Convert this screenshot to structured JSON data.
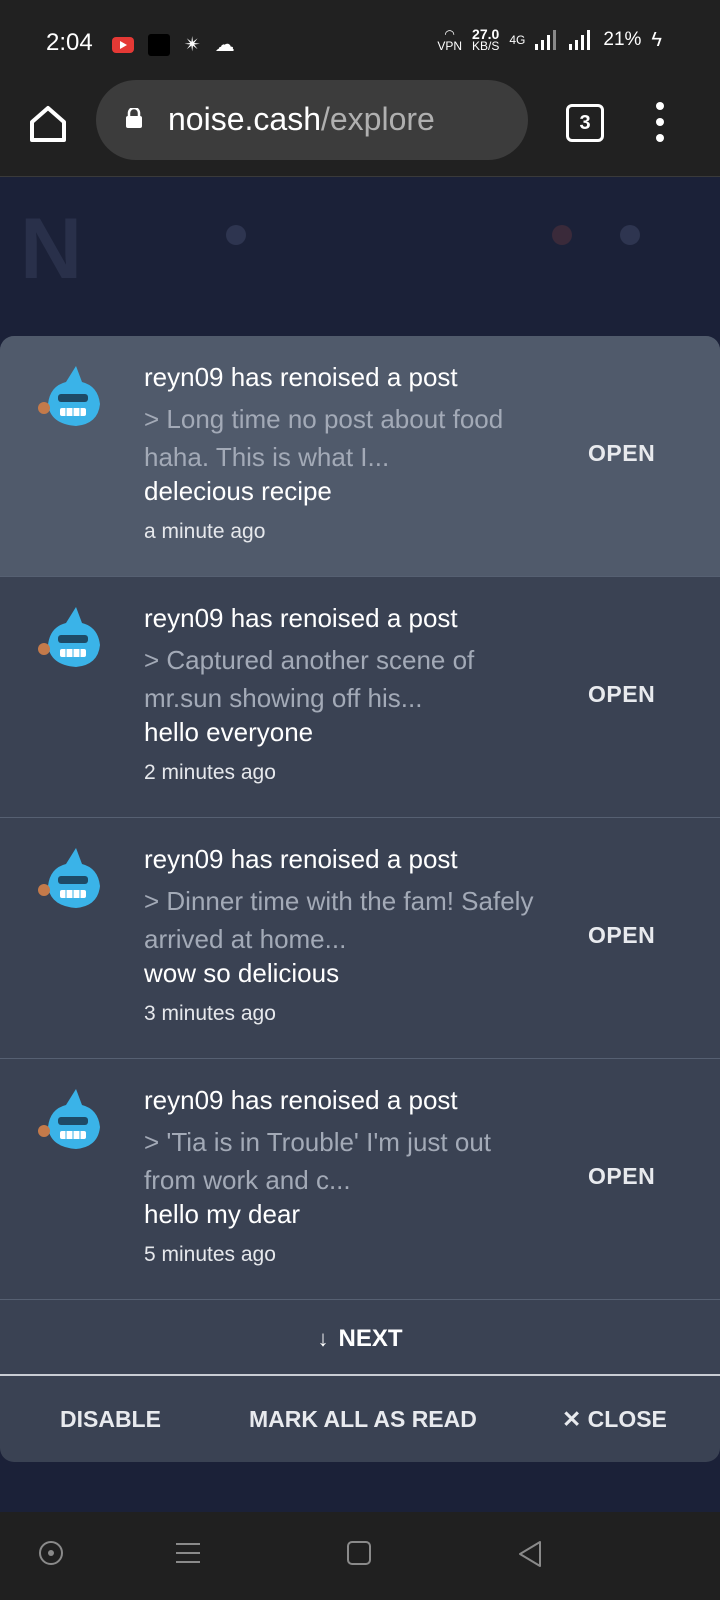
{
  "status_bar": {
    "time": "2:04",
    "vpn": "VPN",
    "speed_value": "27.0",
    "speed_unit": "KB/S",
    "network": "4G",
    "battery": "21%"
  },
  "browser": {
    "url_domain": "noise.cash",
    "url_path": "/explore",
    "tab_count": "3"
  },
  "notifications": [
    {
      "title": "reyn09 has renoised a post",
      "snippet": "> Long time no post about food haha. This is what I...",
      "comment": "delecious recipe",
      "time": "a minute ago",
      "action": "OPEN"
    },
    {
      "title": "reyn09 has renoised a post",
      "snippet": "> Captured another scene of mr.sun showing off his...",
      "comment": "hello everyone",
      "time": "2 minutes ago",
      "action": "OPEN"
    },
    {
      "title": "reyn09 has renoised a post",
      "snippet": "> Dinner time with the fam! Safely arrived at home...",
      "comment": "wow so delicious",
      "time": "3 minutes ago",
      "action": "OPEN"
    },
    {
      "title": "reyn09 has renoised a post",
      "snippet": "> 'Tia is in Trouble' I'm just out from work and c...",
      "comment": "hello my dear",
      "time": "5 minutes ago",
      "action": "OPEN"
    }
  ],
  "panel": {
    "next_label": "NEXT",
    "disable_label": "DISABLE",
    "mark_all_label": "MARK ALL AS READ",
    "close_label": "CLOSE"
  },
  "colors": {
    "panel_bg": "#3a4253",
    "highlight_bg": "#505a6b",
    "avatar_color": "#3ab3e8"
  }
}
